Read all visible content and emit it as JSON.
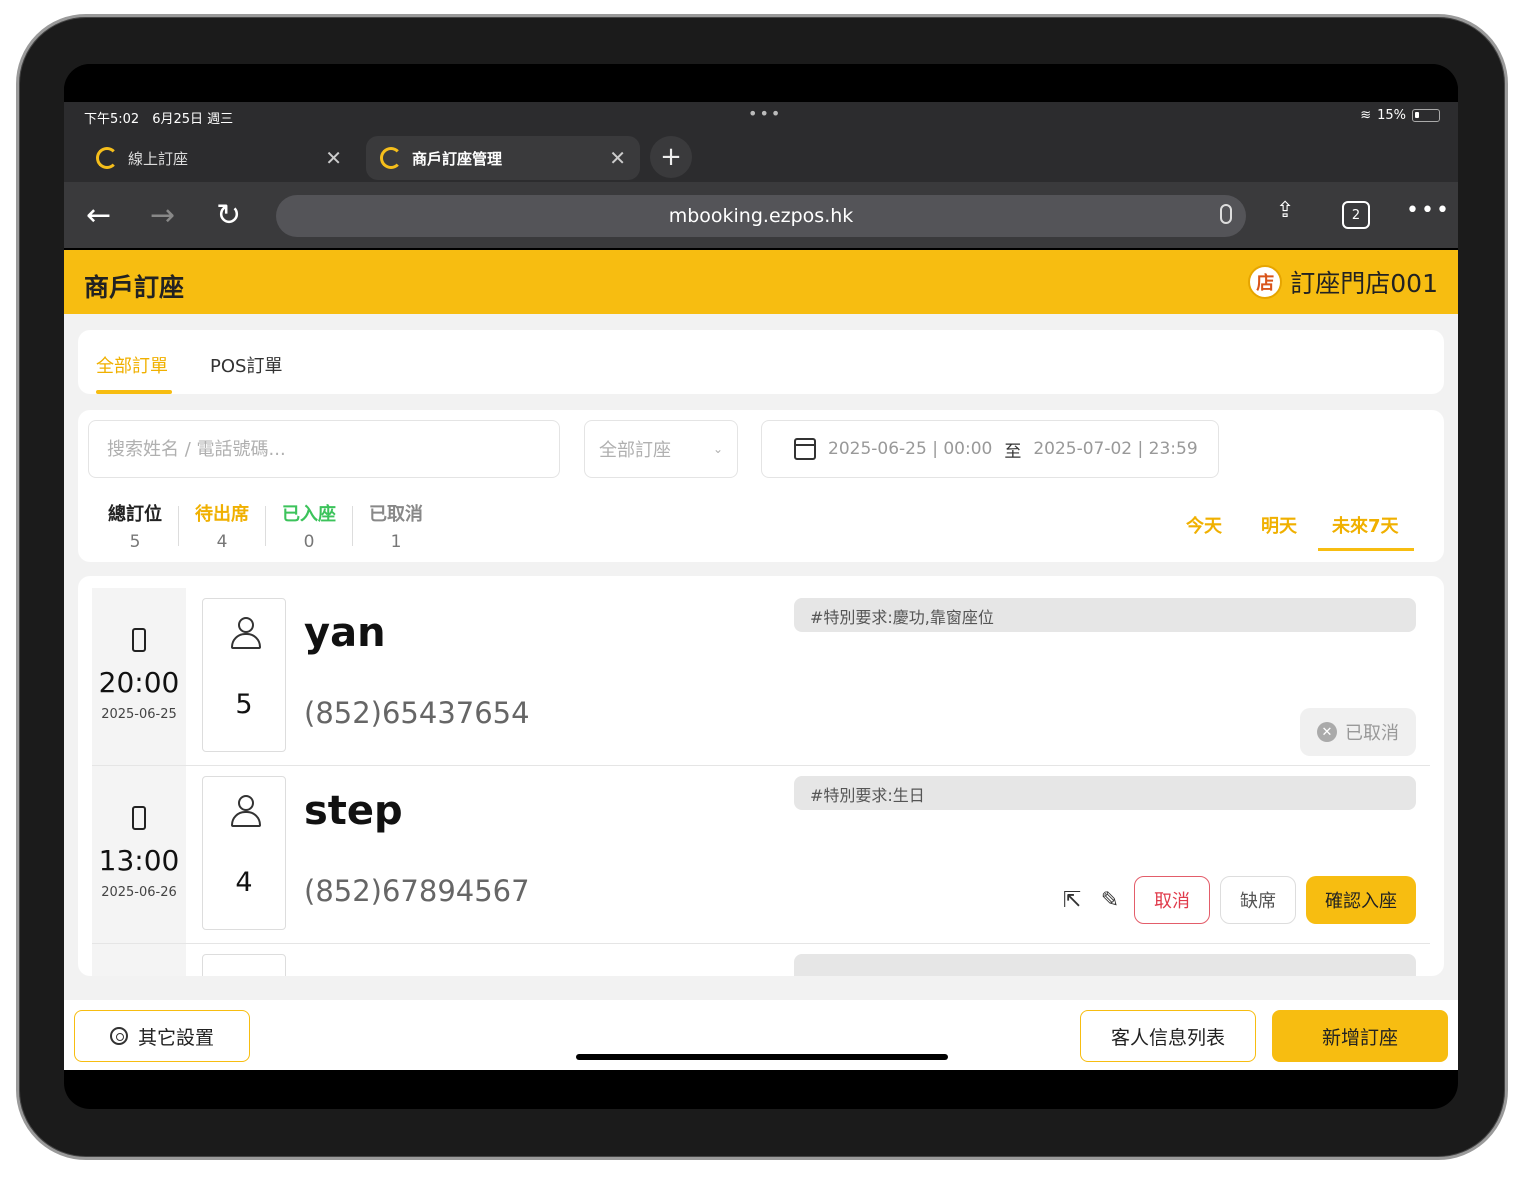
{
  "status_bar": {
    "time": "下午5:02　6月25日 週三",
    "battery": "15%"
  },
  "browser": {
    "tabs": [
      {
        "title": "線上訂座"
      },
      {
        "title": "商戶訂座管理"
      }
    ],
    "url": "mbooking.ezpos.hk",
    "tab_count": "2"
  },
  "header": {
    "title": "商戶訂座",
    "store_icon": "店",
    "store_name": "訂座門店001"
  },
  "segments": [
    {
      "label": "全部訂單"
    },
    {
      "label": "POS訂單"
    }
  ],
  "filters": {
    "search_placeholder": "搜索姓名 / 電話號碼...",
    "type_select": "全部訂座",
    "date_from": "2025-06-25 | 00:00",
    "date_sep": "至",
    "date_to": "2025-07-02 | 23:59"
  },
  "stats": [
    {
      "label": "總訂位",
      "count": "5",
      "color": "#222222"
    },
    {
      "label": "待出席",
      "count": "4",
      "color": "#f0b000"
    },
    {
      "label": "已入座",
      "count": "0",
      "color": "#3cc35b"
    },
    {
      "label": "已取消",
      "count": "1",
      "color": "#888888"
    }
  ],
  "quick_dates": [
    {
      "label": "今天"
    },
    {
      "label": "明天"
    },
    {
      "label": "未來7天"
    }
  ],
  "bookings": [
    {
      "time": "20:00",
      "date": "2025-06-25",
      "guests": "5",
      "name": "yan",
      "phone": "(852)65437654",
      "note": "#特別要求:慶功,靠窗座位",
      "status": "已取消"
    },
    {
      "time": "13:00",
      "date": "2025-06-26",
      "guests": "4",
      "name": "step",
      "phone": "(852)67894567",
      "note": "#特別要求:生日",
      "actions": {
        "cancel": "取消",
        "no_show": "缺席",
        "confirm": "確認入座"
      }
    }
  ],
  "footer": {
    "other_settings": "其它設置",
    "guest_list": "客人信息列表",
    "new_booking": "新增訂座"
  },
  "colors": {
    "brand": "#f7bd11",
    "danger": "#e03b4b",
    "success": "#3cc35b"
  }
}
